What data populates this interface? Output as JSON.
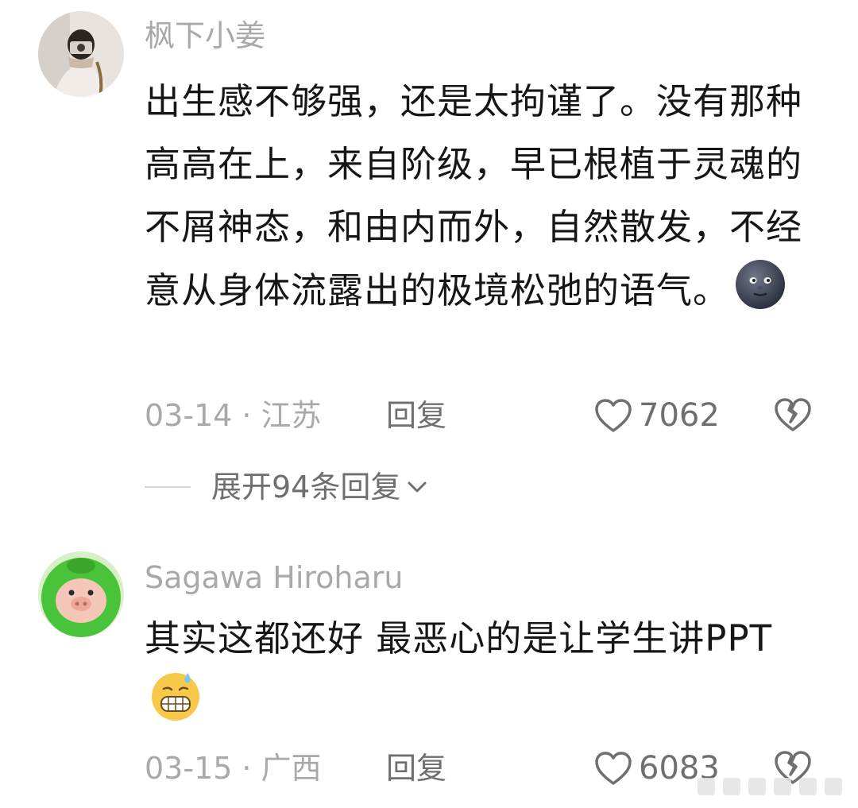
{
  "comments": [
    {
      "username": "枫下小姜",
      "text": "出生感不够强，还是太拘谨了。没有那种高高在上，来自阶级，早已根植于灵魂的不屑神态，和由内而外，自然散发，不经意从身体流露出的极境松弛的语气。",
      "emoji": "new-moon-face-icon",
      "date": "03-14",
      "separator": "·",
      "location": "江苏",
      "reply_label": "回复",
      "likes": "7062"
    },
    {
      "username": "Sagawa Hiroharu",
      "text": "其实这都还好 最恶心的是让学生讲PPT",
      "emoji": "grimacing-sweat-face-icon",
      "date": "03-15",
      "separator": "·",
      "location": "广西",
      "reply_label": "回复",
      "likes": "6083"
    }
  ],
  "expand_replies": "展开94条回复",
  "colors": {
    "username": "#a9a9a9",
    "body_text": "#161616",
    "action": "#6f6f6f",
    "pig_avatar": "#49c43a"
  }
}
